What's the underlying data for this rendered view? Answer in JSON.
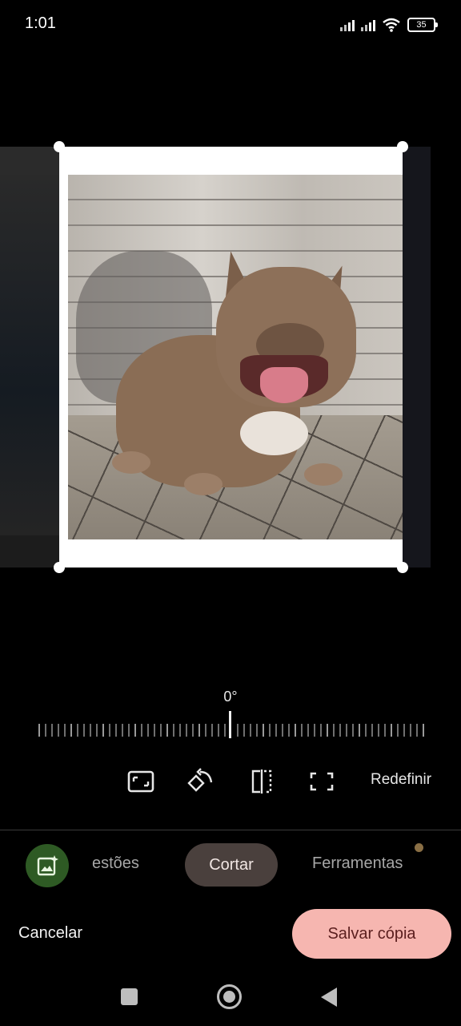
{
  "status_bar": {
    "time": "1:01",
    "battery": "35",
    "icons": [
      "signal-icon",
      "signal-icon",
      "wifi-icon",
      "battery-icon"
    ]
  },
  "crop": {
    "photo_description_icon": "dog-photo"
  },
  "angle": {
    "value": "0°"
  },
  "tools": {
    "aspect_icon": "aspect-ratio-icon",
    "rotate_icon": "rotate-icon",
    "flip_icon": "flip-icon",
    "free_crop_icon": "free-crop-icon",
    "reset_label": "Redefinir"
  },
  "tabs": {
    "ai_icon": "magic-editor-icon",
    "items": [
      {
        "label": "estões",
        "active": false
      },
      {
        "label": "Cortar",
        "active": true
      },
      {
        "label": "Ferramentas",
        "active": false
      }
    ]
  },
  "actions": {
    "cancel_label": "Cancelar",
    "save_label": "Salvar cópia"
  },
  "nav": {
    "recent_icon": "recents-icon",
    "home_icon": "home-icon",
    "back_icon": "back-icon"
  },
  "colors": {
    "save_button": "#f6b6b0",
    "active_tab": "#4a403d",
    "ai_button": "#2e5a24"
  }
}
